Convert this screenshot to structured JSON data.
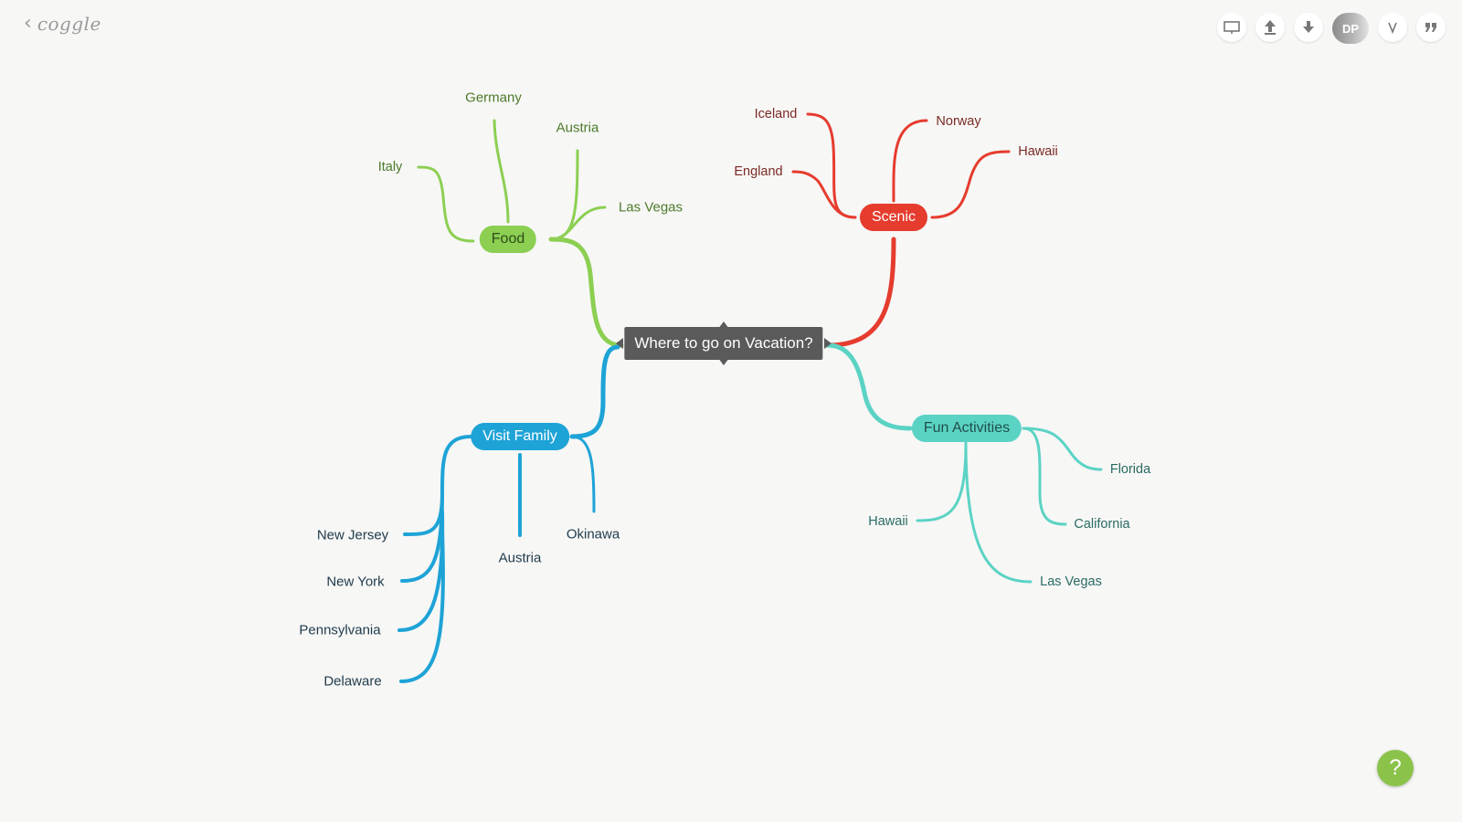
{
  "app": {
    "logo_text": "coggle"
  },
  "toolbar": {
    "avatar_initials": "DP"
  },
  "map": {
    "root": "Where to go on Vacation?",
    "branches": [
      {
        "label": "Food",
        "color": "#8ccf52",
        "text_color": "#4c7a2a",
        "children": [
          "Italy",
          "Germany",
          "Austria",
          "Las Vegas"
        ]
      },
      {
        "label": "Scenic",
        "color": "#e53c2e",
        "text_color": "#7a2a24",
        "children": [
          "Iceland",
          "England",
          "Norway",
          "Hawaii"
        ]
      },
      {
        "label": "Visit Family",
        "color": "#1ea3d6",
        "text_color": "#1f3a4a",
        "children": [
          "New Jersey",
          "New York",
          "Pennsylvania",
          "Delaware",
          "Austria",
          "Okinawa"
        ]
      },
      {
        "label": "Fun Activities",
        "color": "#5bd3c4",
        "text_color": "#2b6b64",
        "children": [
          "Florida",
          "California",
          "Hawaii",
          "Las Vegas"
        ]
      }
    ]
  },
  "help": {
    "label": "?"
  }
}
